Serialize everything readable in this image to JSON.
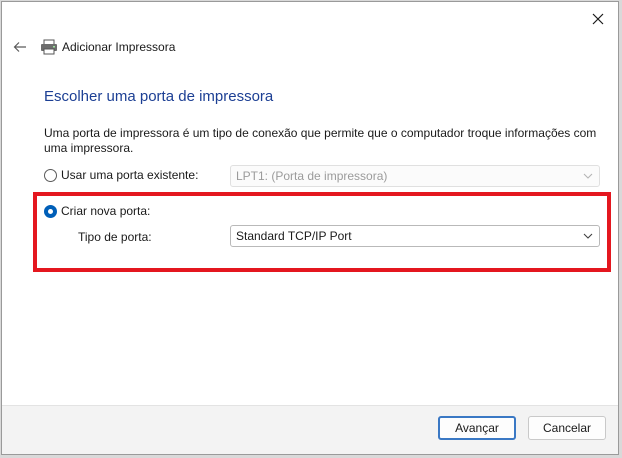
{
  "window": {
    "title": "Adicionar Impressora"
  },
  "page": {
    "heading": "Escolher uma porta de impressora",
    "description": "Uma porta de impressora é um tipo de conexão que permite que o computador troque informações com uma impressora."
  },
  "options": {
    "existing": {
      "label": "Usar uma porta existente:",
      "selected_value": "LPT1: (Porta de impressora)",
      "checked": false
    },
    "new": {
      "label": "Criar nova porta:",
      "checked": true,
      "port_type_label": "Tipo de porta:",
      "port_type_value": "Standard TCP/IP Port"
    }
  },
  "buttons": {
    "next": "Avançar",
    "cancel": "Cancelar"
  },
  "colors": {
    "heading": "#1c3f94",
    "accent": "#005fb8",
    "highlight": "#e4171f"
  }
}
